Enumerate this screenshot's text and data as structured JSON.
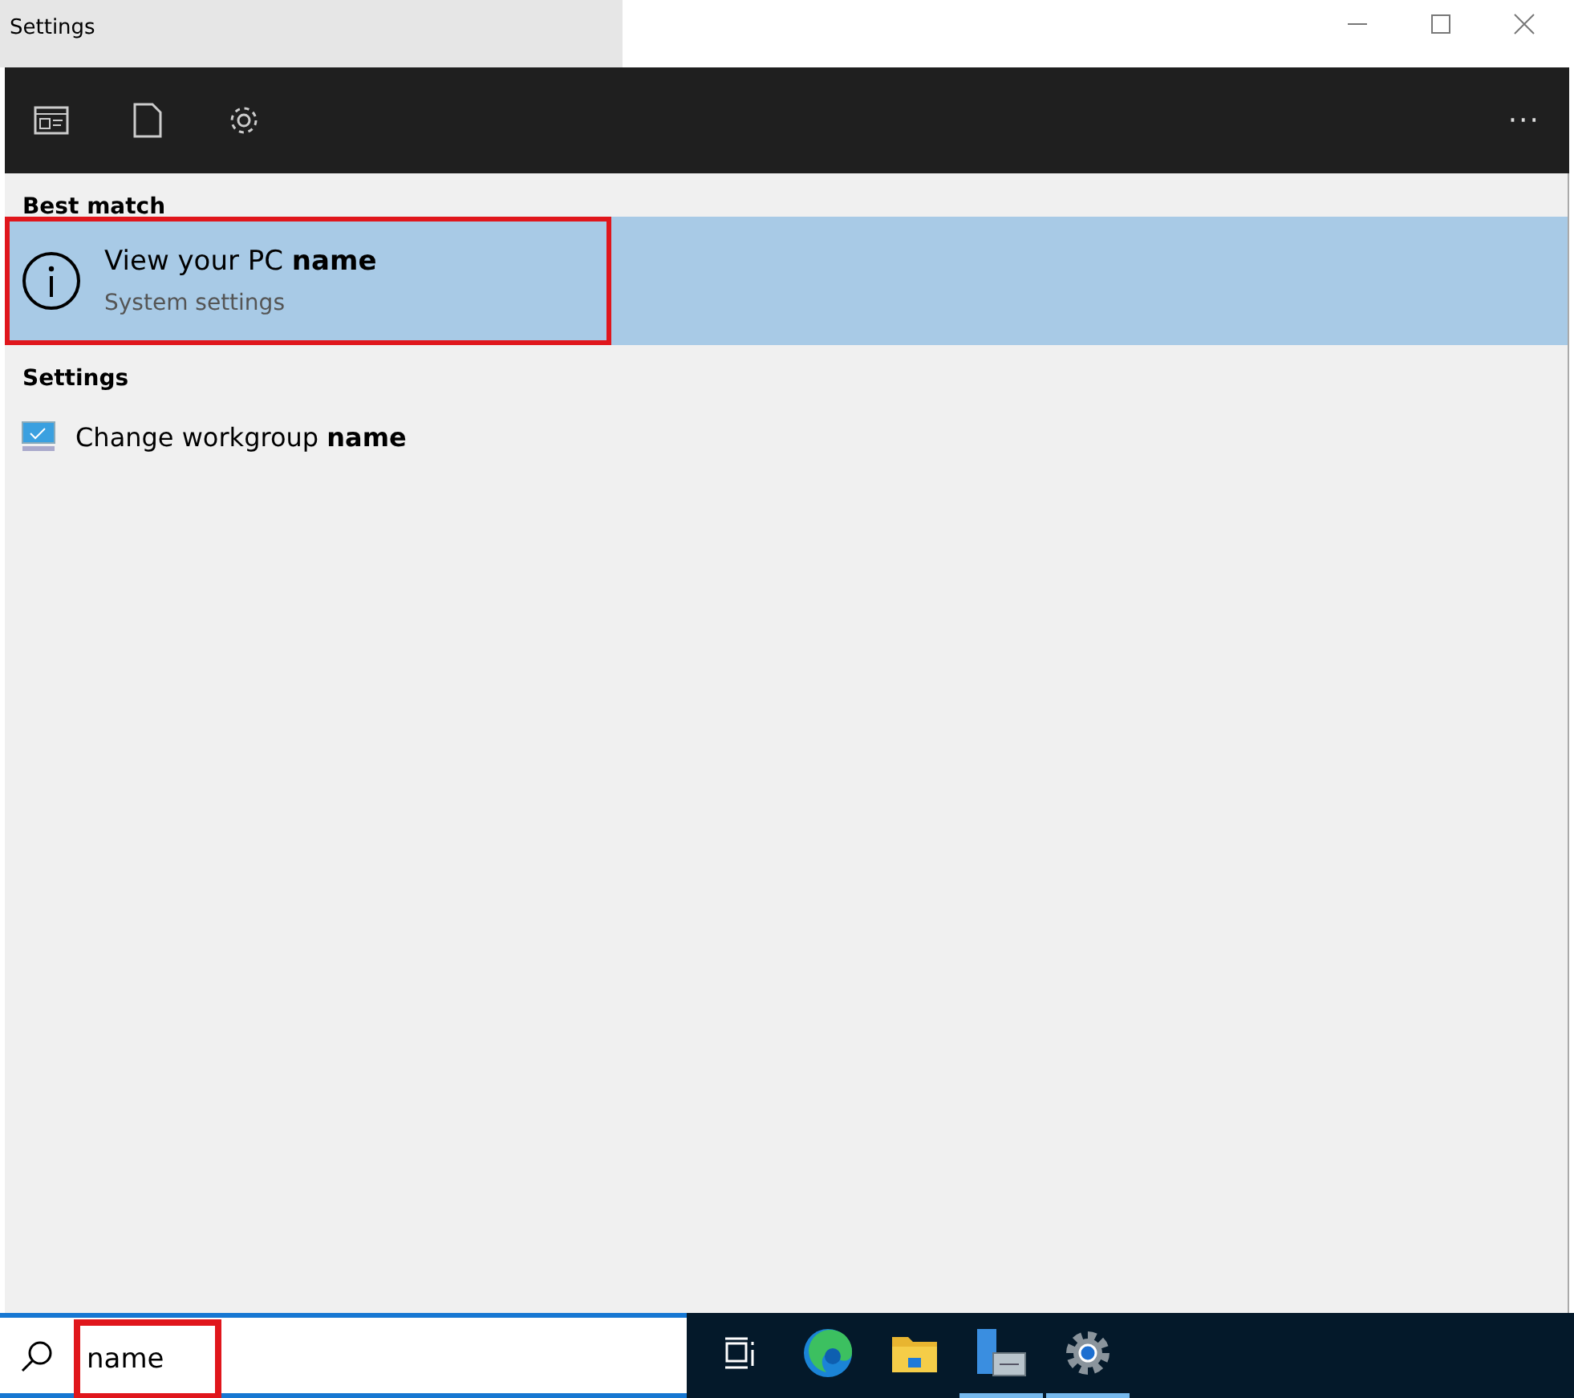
{
  "window": {
    "title": "Settings"
  },
  "toolbar": {
    "more": "···"
  },
  "sections": [
    {
      "heading": "Best match",
      "results": [
        {
          "kind": "info",
          "title": "View your PC **name**",
          "subtitle": "System settings",
          "selected": true,
          "highlighted": true
        }
      ]
    },
    {
      "heading": "Settings",
      "results": [
        {
          "kind": "monitor",
          "title": "Change workgroup **name**",
          "selected": false,
          "highlighted": false
        }
      ]
    }
  ],
  "search": {
    "value": "name",
    "highlighted": true
  },
  "taskbar": [
    {
      "kind": "taskview",
      "running": false
    },
    {
      "kind": "edge",
      "running": false
    },
    {
      "kind": "folder",
      "running": false
    },
    {
      "kind": "server",
      "running": true
    },
    {
      "kind": "gear",
      "running": true
    }
  ]
}
